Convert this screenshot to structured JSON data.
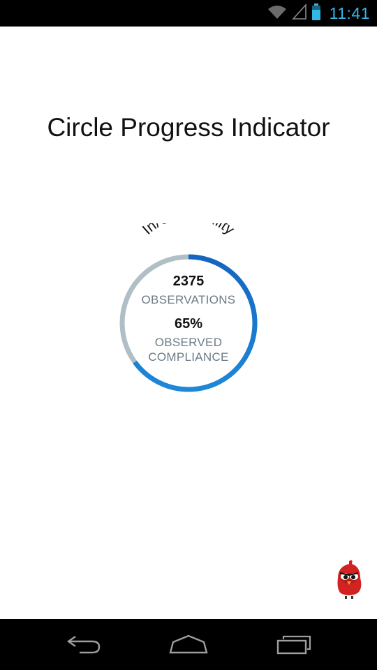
{
  "status_bar": {
    "time": "11:41",
    "icons": [
      "wifi-icon",
      "cell-signal-icon",
      "battery-icon"
    ]
  },
  "page": {
    "title": "Circle Progress Indicator"
  },
  "progress": {
    "arc_label": "In/Out Facility",
    "observations_count": "2375",
    "observations_label": "OBSERVATIONS",
    "compliance_percent": "65%",
    "compliance_label": "OBSERVED COMPLIANCE",
    "compliance_fraction": 0.65,
    "colors": {
      "track": "#b0bec5",
      "progress_start": "#1e88d8",
      "progress_end": "#1565c0"
    }
  },
  "nav_bar": {
    "icons": [
      "back-icon",
      "home-icon",
      "recent-apps-icon"
    ]
  },
  "mascot": {
    "icon": "red-bird-mascot-icon"
  }
}
